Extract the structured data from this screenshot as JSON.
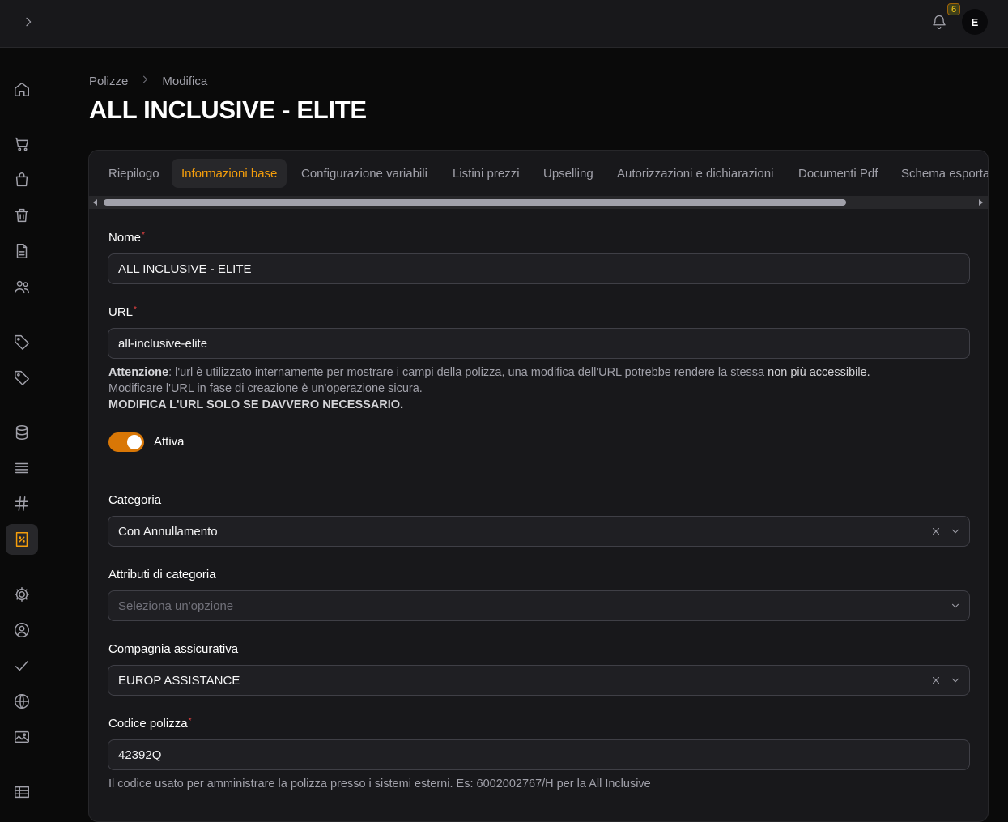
{
  "topbar": {
    "notification_count": "6",
    "avatar_initial": "E"
  },
  "breadcrumb": {
    "items": [
      "Polizze",
      "Modifica"
    ]
  },
  "page": {
    "title": "ALL INCLUSIVE - ELITE"
  },
  "tabs": [
    {
      "label": "Riepilogo"
    },
    {
      "label": "Informazioni base"
    },
    {
      "label": "Configurazione variabili"
    },
    {
      "label": "Listini prezzi"
    },
    {
      "label": "Upselling"
    },
    {
      "label": "Autorizzazioni e dichiarazioni"
    },
    {
      "label": "Documenti Pdf"
    },
    {
      "label": "Schema esporta"
    }
  ],
  "form": {
    "nome": {
      "label": "Nome",
      "required": "*",
      "value": "ALL INCLUSIVE - ELITE"
    },
    "url": {
      "label": "URL",
      "required": "*",
      "value": "all-inclusive-elite",
      "warning_strong": "Attenzione",
      "warning_text": ": l'url è utilizzato internamente per mostrare i campi della polizza, una modifica dell'URL potrebbe rendere la stessa ",
      "warning_link": "non più accessibile.",
      "warning_line2": "Modificare l'URL in fase di creazione è un'operazione sicura.",
      "warning_line3": "MODIFICA L'URL SOLO SE DAVVERO NECESSARIO."
    },
    "attiva": {
      "label": "Attiva",
      "checked": true
    },
    "categoria": {
      "label": "Categoria",
      "value": "Con Annullamento"
    },
    "attributi": {
      "label": "Attributi di categoria",
      "placeholder": "Seleziona un'opzione"
    },
    "compagnia": {
      "label": "Compagnia assicurativa",
      "value": "EUROP ASSISTANCE"
    },
    "codice": {
      "label": "Codice polizza",
      "required": "*",
      "value": "42392Q",
      "help": "Il codice usato per amministrare la polizza presso i sistemi esterni. Es: 6002002767/H per la All Inclusive"
    }
  },
  "colors": {
    "accent": "#f59e0b",
    "toggle": "#d97706",
    "background": "#0a0a0a",
    "surface": "#18181b"
  }
}
